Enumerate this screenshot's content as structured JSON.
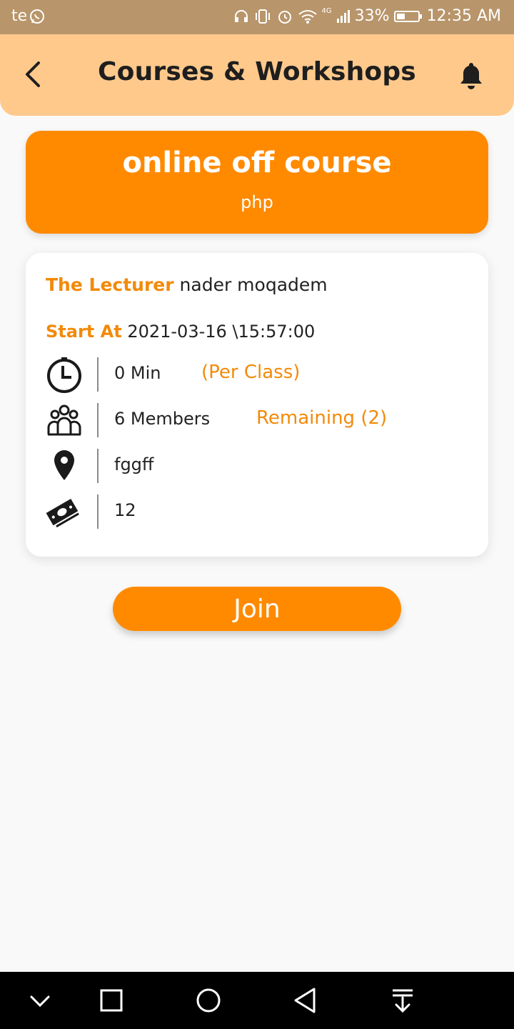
{
  "status_bar": {
    "carrier": "te",
    "battery": "33%",
    "time": "12:35 AM",
    "network": "4G"
  },
  "header": {
    "title": "Courses & Workshops"
  },
  "course": {
    "title": "online off course",
    "subtitle": "php"
  },
  "details": {
    "lecturer_label": "The Lecturer",
    "lecturer_name": "nader moqadem",
    "start_label": "Start At",
    "start_value": "2021-03-16 \\15:57:00",
    "duration": "0 Min",
    "duration_note": "(Per Class)",
    "members": "6 Members",
    "remaining": "Remaining (2)",
    "location": "fggff",
    "price": "12"
  },
  "actions": {
    "join_label": "Join"
  },
  "colors": {
    "accent": "#ff8a00",
    "header_bg": "#ffc98c",
    "status_bar_bg": "#b8956a"
  },
  "icons": {
    "back": "chevron-left-icon",
    "notifications": "bell-icon",
    "duration": "clock-icon",
    "members": "group-icon",
    "location": "map-pin-icon",
    "price": "cash-icon"
  }
}
